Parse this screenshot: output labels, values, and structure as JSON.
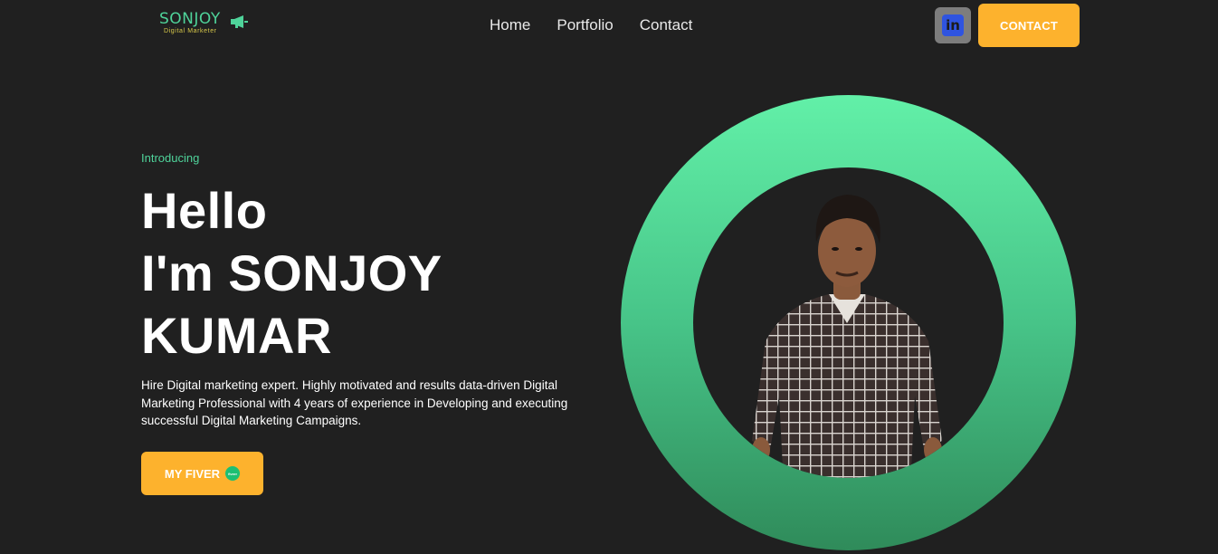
{
  "header": {
    "logo": {
      "name": "SONJOY",
      "tagline": "Digital Marketer",
      "icon": "megaphone-icon"
    },
    "nav": [
      {
        "label": "Home"
      },
      {
        "label": "Portfolio"
      },
      {
        "label": "Contact"
      }
    ],
    "linkedin": {
      "label": "in",
      "icon": "linkedin-icon"
    },
    "contact_button": "CONTACT"
  },
  "hero": {
    "intro": "Introducing",
    "title_lines": [
      "Hello",
      "I'm SONJOY",
      "KUMAR"
    ],
    "description": "Hire Digital marketing expert. Highly motivated and results data-driven Digital Marketing Professional with 4 years of experience in Developing and executing successful Digital Marketing Campaigns.",
    "cta_label": "MY FIVER",
    "cta_icon": "fiverr-icon",
    "cta_icon_text": "fiverr"
  },
  "portrait": {
    "icon": "portrait-photo"
  },
  "colors": {
    "background": "#202020",
    "accent_green": "#4fd39a",
    "accent_orange": "#fdb22d",
    "linkedin_blue": "#2f54e0"
  }
}
